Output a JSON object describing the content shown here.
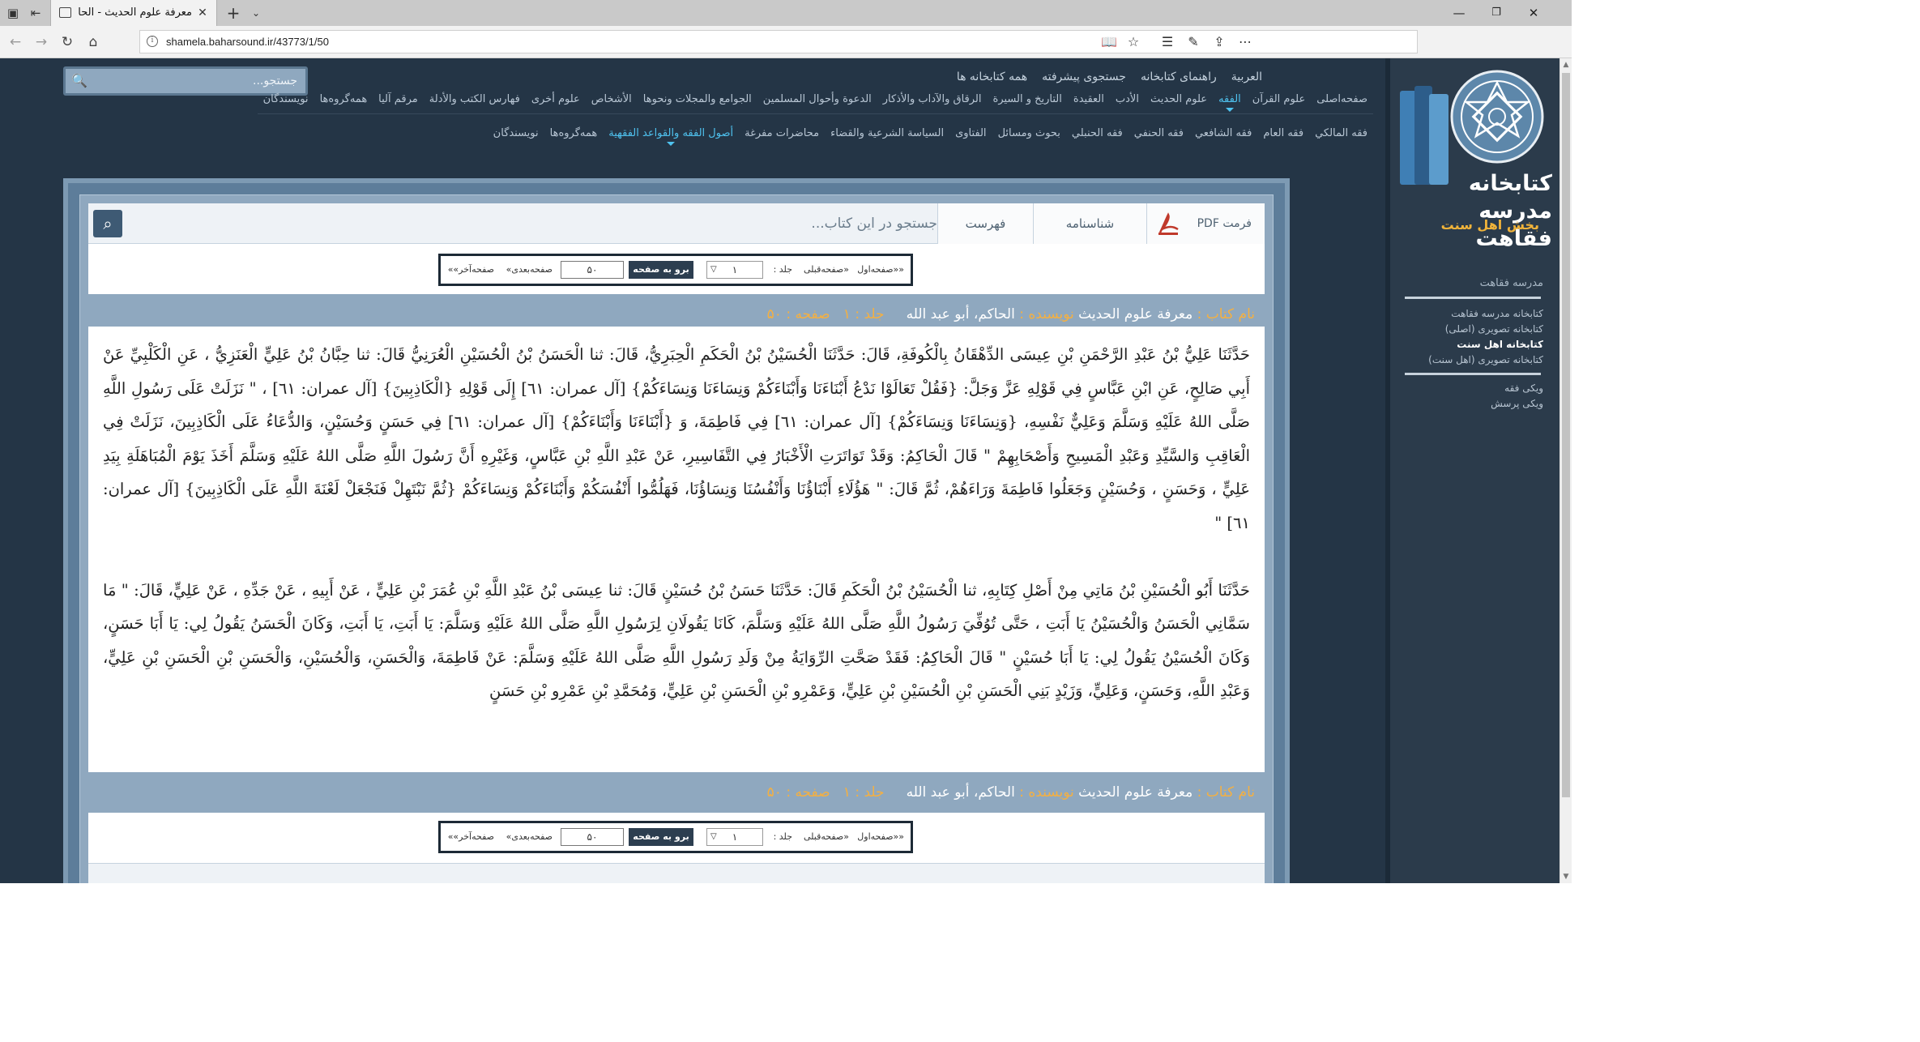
{
  "browser": {
    "tab_title": "معرفة علوم الحديث - الحا",
    "url": "shamela.baharsound.ir/43773/1/50",
    "icons": [
      "tab-list-icon",
      "tab-preview-icon",
      "close-icon",
      "new-tab-icon",
      "chevron-down-icon",
      "minimize-icon",
      "maximize-icon",
      "window-close-icon",
      "back-icon",
      "forward-icon",
      "refresh-icon",
      "home-icon",
      "info-icon",
      "reading-view-icon",
      "star-icon",
      "favorites-icon",
      "pen-icon",
      "share-icon",
      "more-icon"
    ]
  },
  "sidebar": {
    "logo_title": "کتابخانه مدرسه فقاهت",
    "logo_sub": "بخش اهل سنت",
    "section_title": "مدرسه فقاهت",
    "links": [
      "کتابخانه مدرسه فقاهت",
      "کتابخانه تصویری (اصلی)",
      "کتابخانه اهل سنت",
      "کتابخانه تصویری (اهل سنت)"
    ],
    "extra_links": [
      "ویکی فقه",
      "ویکی پرسش"
    ]
  },
  "search": {
    "placeholder": "جستجو..."
  },
  "top_nav": [
    "العربية",
    "راهنمای کتابخانه",
    "جستجوی پیشرفته",
    "همه کتابخانه ها"
  ],
  "main_nav": [
    "صفحه‌اصلی",
    "علوم القرآن",
    "الفقه",
    "علوم الحديث",
    "الأدب",
    "العقيدة",
    "التاريخ و السيرة",
    "الرقاق والآداب والأذكار",
    "الدعوة وأحوال المسلمين",
    "الجوامع والمجلات ونحوها",
    "الأشخاص",
    "علوم أخرى",
    "فهارس الكتب والأدلة",
    "مرقم آليا",
    "همه‌گروه‌ها",
    "نویسندگان"
  ],
  "main_nav_active": "الفقه",
  "sub_nav": [
    "فقه المالكي",
    "فقه العام",
    "فقه الشافعي",
    "فقه الحنفي",
    "فقه الحنبلي",
    "بحوث ومسائل",
    "الفتاوى",
    "السياسة الشرعية والقضاء",
    "محاضرات مفرغة",
    "أصول الفقه والقواعد الفقهية",
    "همه‌گروه‌ها",
    "نویسندگان"
  ],
  "sub_nav_active": "أصول الفقه والقواعد الفقهية",
  "book_bar": {
    "pdf_label": "فرمت PDF",
    "shenasnameh": "شناسنامه",
    "fehrest": "فهرست",
    "search_placeholder": "جستجو در این کتاب..."
  },
  "pager": {
    "first": "««صفحه‌اول",
    "prev": "«صفحه‌قبلی",
    "volume_label": "جلد :",
    "volume_value": "۱",
    "go_label": "برو به صفحه",
    "page_value": "۵۰",
    "next": "صفحه‌بعدی»",
    "last": "صفحه‌آخر»»"
  },
  "book_info": {
    "name_label": "نام کتاب :",
    "name": "معرفة علوم الحديث",
    "author_label": "نویسنده :",
    "author": "الحاكم، أبو عبد الله",
    "volume_label": "جلد :",
    "volume": "۱",
    "page_label": "صفحه :",
    "page": "۵۰"
  },
  "text": {
    "paragraph1": "حَدَّثَنَا عَلِيُّ بْنُ عَبْدِ الرَّحْمَنِ بْنِ عِيسَى الدِّهْقَانُ بِالْكُوفَةِ، قَالَ: حَدَّثَنَا الْحُسَيْنُ بْنُ الْحَكَمِ الْحِبَرِيُّ، قَالَ: ثنا الْحَسَنُ بْنُ الْحُسَيْنِ الْعُرَنِيُّ قَالَ: ثنا حِبَّانُ بْنُ عَلِيٍّ الْعَنَزِيُّ ، عَنِ الْكَلْبِيِّ عَنْ أَبِي صَالِحٍ، عَنِ ابْنِ عَبَّاسٍ فِي قَوْلِهِ عَزَّ وَجَلَّ: {فَقُلْ تَعَالَوْا نَدْعُ أَبْنَاءَنَا وَأَبْنَاءَكُمْ وَنِسَاءَنَا وَنِسَاءَكُمْ} [آل عمران: ٦١] إِلَى قَوْلِهِ {الْكَاذِبِينَ} [آل عمران: ٦١] ، \" نَزَلَتْ عَلَى رَسُولِ اللَّهِ صَلَّى اللهُ عَلَيْهِ وَسَلَّمَ وَعَلِيٌّ نَفْسِهِ، {وَنِسَاءَنَا وَنِسَاءَكُمْ} [آل عمران: ٦١] فِي فَاطِمَةَ، وَ {أَبْنَاءَنَا وَأَبْنَاءَكُمْ} [آل عمران: ٦١] فِي حَسَنٍ وَحُسَيْنٍ، وَالدُّعَاءُ عَلَى الْكَاذِبِينَ، نَزَلَتْ فِي الْعَاقِبِ وَالسَّيِّدِ وَعَبْدِ الْمَسِيحِ وَأَصْحَابِهِمْ \" قَالَ الْحَاكِمُ: وَقَدْ تَوَاتَرَتِ الْأَخْبَارُ فِي التَّفَاسِيرِ، عَنْ عَبْدِ اللَّهِ بْنِ عَبَّاسٍ، وَغَيْرِهِ أَنَّ رَسُولَ اللَّهِ صَلَّى اللهُ عَلَيْهِ وَسَلَّمَ أَخَذَ يَوْمَ الْمُبَاهَلَةِ بِيَدِ عَلِيٍّ ، وَحَسَنٍ ، وَحُسَيْنٍ وَجَعَلُوا فَاطِمَةَ وَرَاءَهُمْ، ثُمَّ قَالَ: \" هَؤُلَاءِ أَبْنَاؤُنَا وَأَنْفُسُنَا وَنِسَاؤُنَا، فَهَلُمُّوا أَنْفُسَكُمْ وَأَبْنَاءَكُمْ وَنِسَاءَكُمْ {ثُمَّ نَبْتَهِلْ فَنَجْعَلْ لَعْنَةَ اللَّهِ عَلَى الْكَاذِبِينَ} [آل عمران: ٦١] \"",
    "paragraph2": "حَدَّثَنَا أَبُو الْحُسَيْنِ بْنُ مَاتِي مِنْ أَصْلِ كِتَابِهِ، ثنا الْحُسَيْنُ بْنُ الْحَكَمِ قَالَ: حَدَّثَنَا حَسَنُ بْنُ حُسَيْنٍ قَالَ: ثنا عِيسَى بْنُ عَبْدِ اللَّهِ بْنِ عُمَرَ بْنِ عَلِيٍّ ، عَنْ أَبِيهِ ، عَنْ جَدِّهِ ، عَنْ عَلِيٍّ، قَالَ: \" مَا سَمَّانِي الْحَسَنُ وَالْحُسَيْنُ يَا أَبَتِ ، حَتَّى تُوُفِّيَ رَسُولُ اللَّهِ صَلَّى اللهُ عَلَيْهِ وَسَلَّمَ، كَانَا يَقُولَانِ لِرَسُولِ اللَّهِ صَلَّى اللهُ عَلَيْهِ وَسَلَّمَ: يَا أَبَتِ، يَا أَبَتِ، وَكَانَ الْحَسَنُ يَقُولُ لِي: يَا أَبَا حَسَنٍ، وَكَانَ الْحُسَيْنُ يَقُولُ لِي: يَا أَبَا حُسَيْنٍ \" قَالَ الْحَاكِمُ: فَقَدْ صَحَّتِ الرِّوَايَةُ مِنْ وَلَدِ رَسُولِ اللَّهِ صَلَّى اللهُ عَلَيْهِ وَسَلَّمَ: عَنْ فَاطِمَةَ، وَالْحَسَنِ، وَالْحُسَيْنِ، وَالْحَسَنِ بْنِ الْحَسَنِ بْنِ عَلِيٍّ، وَعَبْدِ اللَّهِ، وَحَسَنٍ، وَعَلِيٍّ، وَزَيْدٍ بَنِي الْحَسَنِ بْنِ الْحُسَيْنِ بْنِ عَلِيٍّ، وَعَمْرِو بْنِ الْحَسَنِ بْنِ عَلِيٍّ، وَمُحَمَّدِ بْنِ عَمْرِو بْنِ حَسَنٍ"
  }
}
